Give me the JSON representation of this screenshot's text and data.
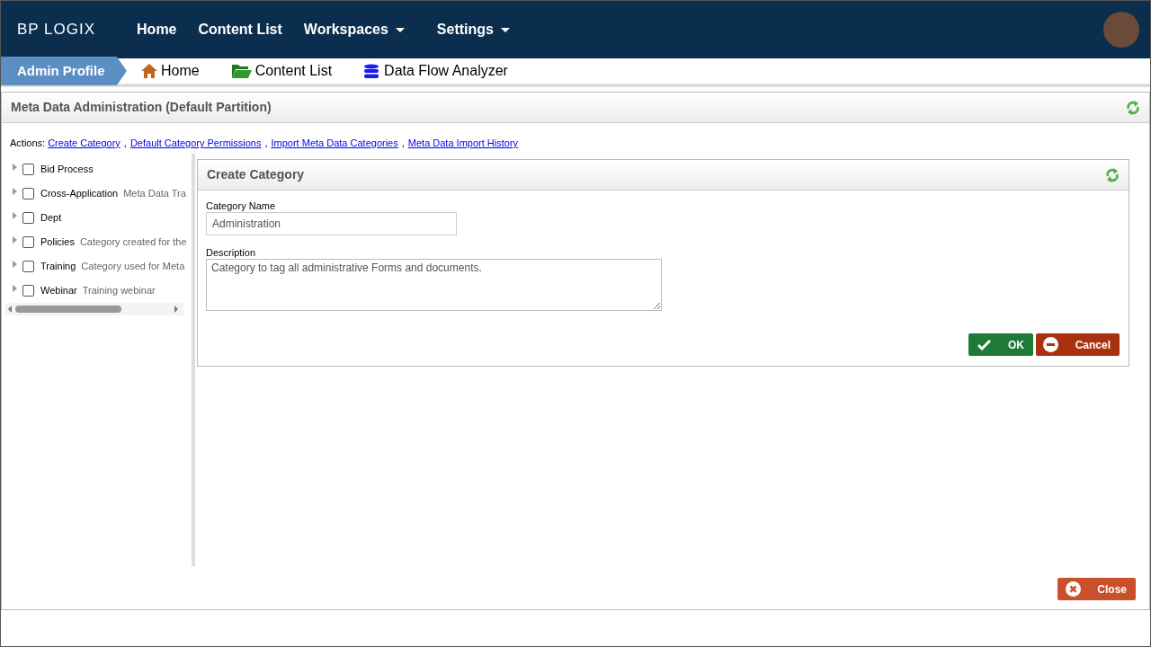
{
  "navbar": {
    "logo": "BP LOGIX",
    "items": [
      {
        "label": "Home",
        "dropdown": false
      },
      {
        "label": "Content List",
        "dropdown": false
      },
      {
        "label": "Workspaces",
        "dropdown": true
      },
      {
        "label": "Settings",
        "dropdown": true
      }
    ]
  },
  "breadcrumb": {
    "profile": "Admin Profile",
    "links": [
      {
        "label": "Home",
        "kind": "home"
      },
      {
        "label": "Content List",
        "kind": "folder"
      },
      {
        "label": "Data Flow Analyzer",
        "kind": "database"
      }
    ]
  },
  "panel": {
    "title": "Meta Data Administration (Default Partition)",
    "actions_label": "Actions:",
    "separator": ",",
    "actions": [
      "Create Category",
      "Default Category Permissions",
      "Import Meta Data Categories",
      "Meta Data Import History"
    ]
  },
  "tree": [
    {
      "name": "Bid Process",
      "checked": false
    },
    {
      "name": "Cross-Application",
      "description": "Meta Data Tra",
      "checked": false
    },
    {
      "name": "Dept",
      "checked": false
    },
    {
      "name": "Policies",
      "description": "Category created for the",
      "checked": false
    },
    {
      "name": "Training",
      "description": "Category used for Meta",
      "checked": false
    },
    {
      "name": "Webinar",
      "description": "Training webinar",
      "checked": false
    }
  ],
  "form": {
    "title": "Create Category",
    "fields": [
      {
        "label": "Category Name",
        "value": "Administration",
        "kind": "text"
      },
      {
        "label": "Description",
        "value": "Category to tag all administrative Forms and documents.",
        "kind": "textarea"
      }
    ],
    "ok": "OK",
    "cancel": "Cancel"
  },
  "close": "Close"
}
